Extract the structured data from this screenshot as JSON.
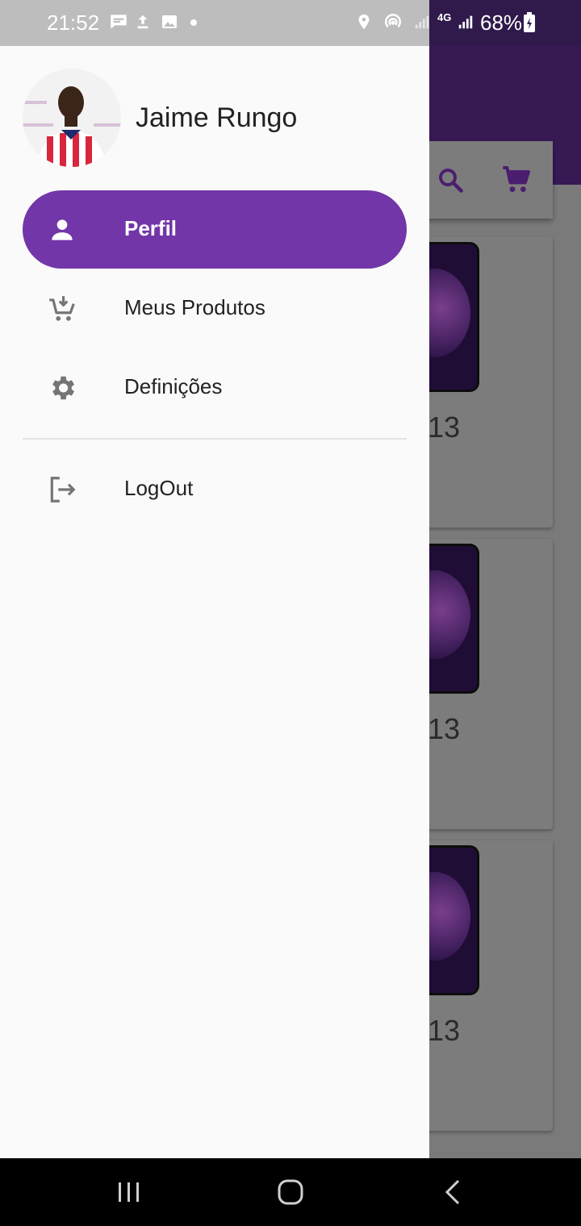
{
  "status_bar": {
    "time": "21:52",
    "battery": "68%",
    "network": "4G",
    "icons": [
      "message-icon",
      "upload-icon",
      "image-icon",
      "dot-icon",
      "location-icon",
      "hotspot-icon",
      "signal-icon",
      "signal-icon",
      "battery-icon"
    ]
  },
  "background_app": {
    "product_titles": [
      "13",
      "13",
      "13"
    ],
    "colors": {
      "header": "#371954",
      "accent": "#4b1d6f"
    }
  },
  "drawer": {
    "user_name": "Jaime Rungo",
    "menu": [
      {
        "label": "Perfil",
        "icon": "person-icon",
        "active": true
      },
      {
        "label": "Meus Produtos",
        "icon": "cart-add-icon",
        "active": false
      },
      {
        "label": "Definições",
        "icon": "gear-icon",
        "active": false
      }
    ],
    "logout_label": "LogOut",
    "colors": {
      "active_bg": "#7236a8",
      "icon_gray": "#757575"
    }
  }
}
